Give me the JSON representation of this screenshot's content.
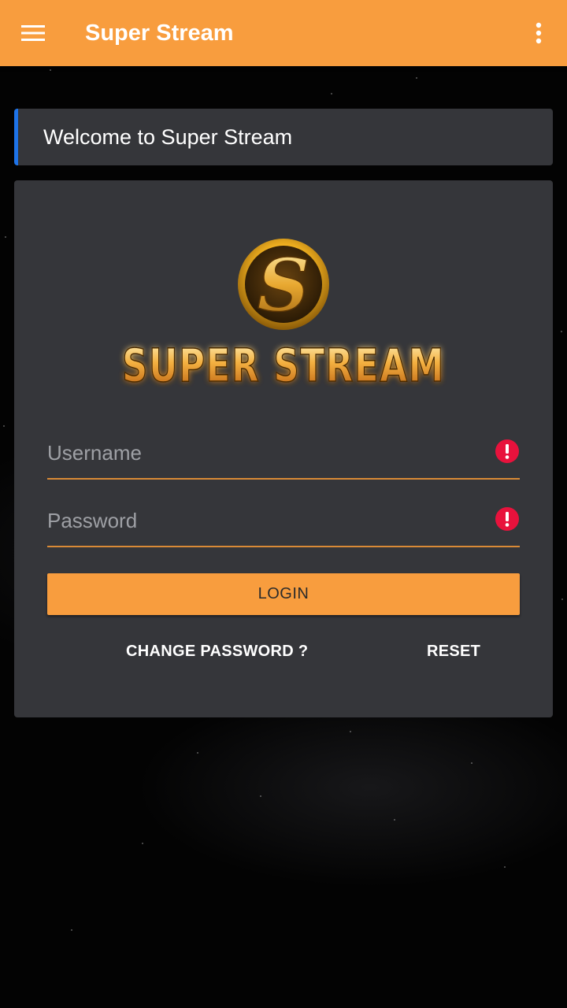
{
  "app_bar": {
    "title": "Super Stream",
    "menu_icon": "hamburger-menu-icon",
    "overflow_icon": "more-vert-icon",
    "background_color": "#f89d3e"
  },
  "welcome": {
    "text": "Welcome to Super Stream",
    "accent_color": "#1e73e8"
  },
  "logo": {
    "emblem_letter": "S",
    "wordmark": "SUPER STREAM"
  },
  "login_form": {
    "username": {
      "placeholder": "Username",
      "value": "",
      "error_icon": "error-alert-icon"
    },
    "password": {
      "placeholder": "Password",
      "value": "",
      "error_icon": "error-alert-icon"
    },
    "login_label": "LOGIN",
    "change_password_label": "CHANGE PASSWORD ?",
    "reset_label": "RESET"
  },
  "colors": {
    "accent": "#f89d3e",
    "card": "#35363a",
    "error": "#e8123c"
  }
}
